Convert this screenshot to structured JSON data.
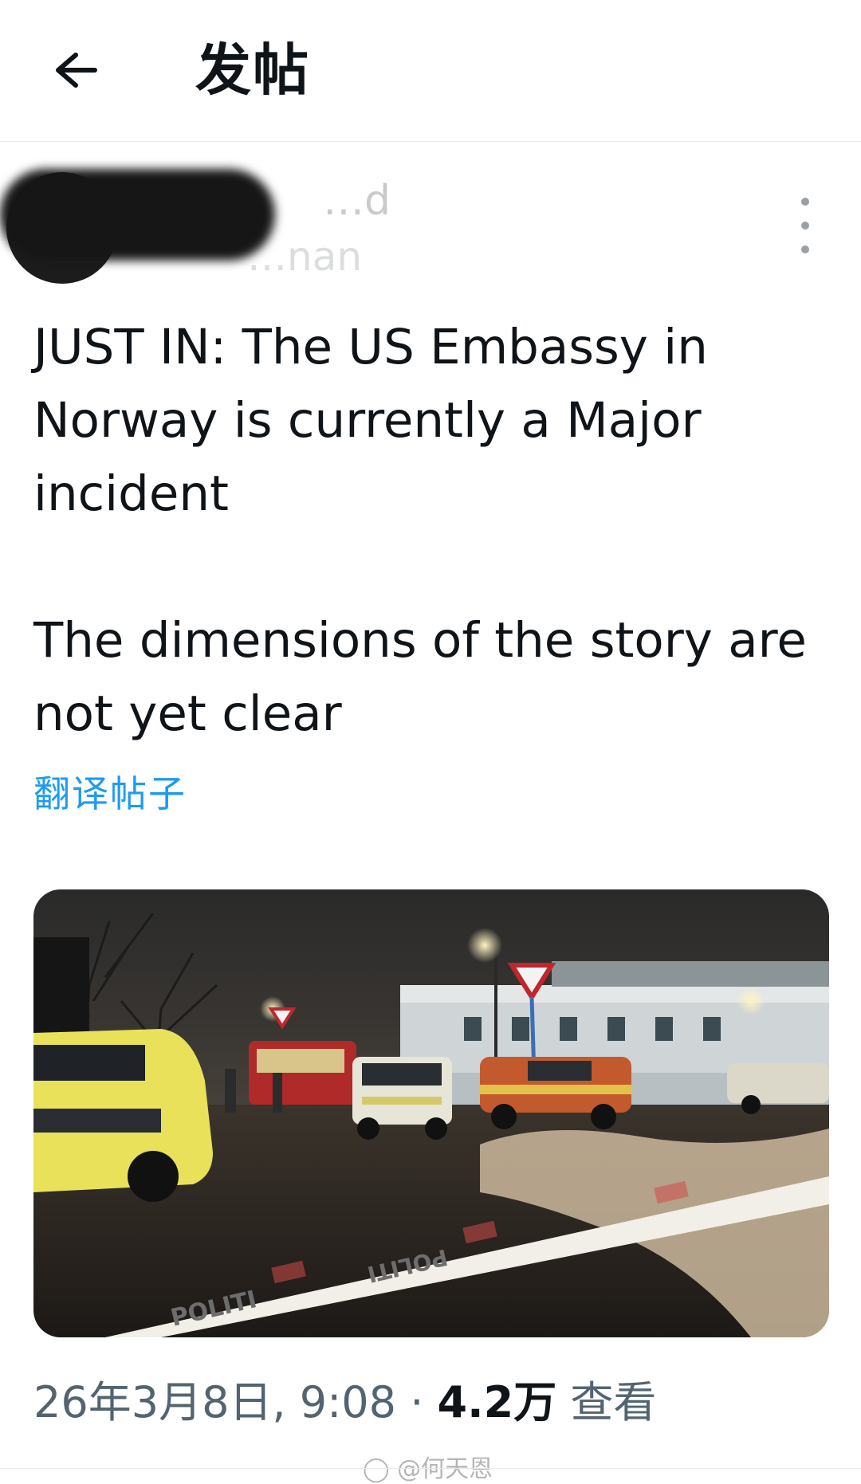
{
  "header": {
    "title": "发帖"
  },
  "author": {
    "display_name": "…d",
    "handle": "…nan"
  },
  "tweet": {
    "paragraphs": [
      "JUST IN: The US Embassy in Norway is currently a Major incident",
      "The dimensions of the story are not yet clear"
    ],
    "translate_label": "翻译帖子"
  },
  "media": {
    "tape_text": "POLITI"
  },
  "meta": {
    "timestamp": "26年3月8日, 9:08",
    "separator": "·",
    "views_count": "4.2万",
    "views_label": "查看"
  },
  "watermark": "@何天恩",
  "colors": {
    "link": "#1d9bf0",
    "secondary_text": "#536471",
    "primary_text": "#0f1419"
  },
  "icons": {
    "back": "arrow-left-icon",
    "more": "vertical-dots-icon",
    "watermark": "weibo-logo-icon"
  }
}
